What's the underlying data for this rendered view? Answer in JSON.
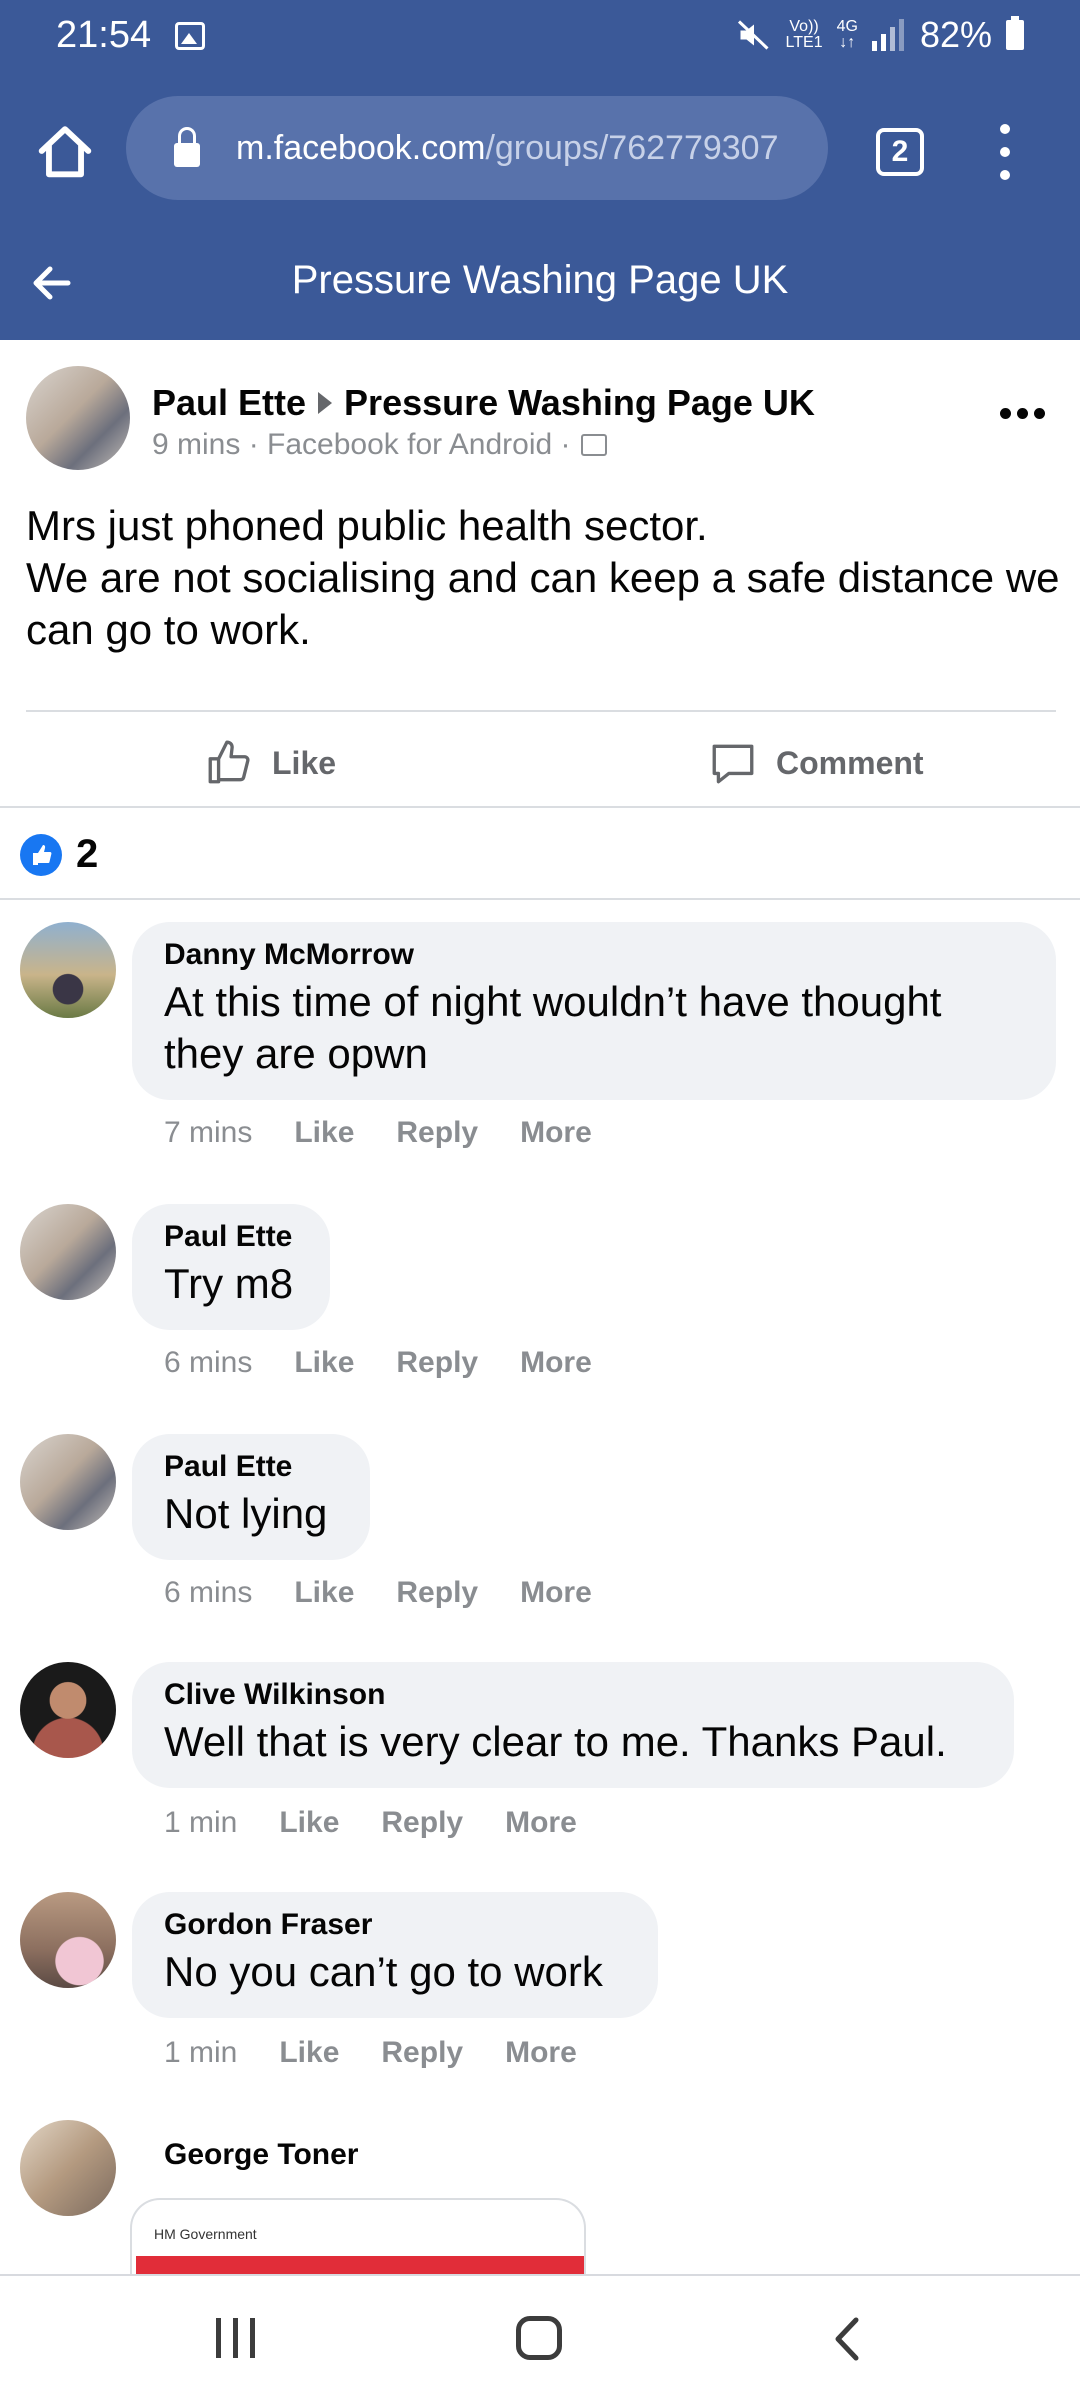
{
  "status_bar": {
    "time": "21:54",
    "volte": "Vo))",
    "lte": "LTE1",
    "network": "4G",
    "battery": "82%"
  },
  "browser": {
    "url_domain": "m.facebook.com",
    "url_path": "/groups/762779307",
    "tab_count": "2"
  },
  "header": {
    "title": "Pressure Washing Page UK"
  },
  "post": {
    "author": "Paul Ette",
    "group": "Pressure Washing Page UK",
    "meta": "9 mins · Facebook for Android ·",
    "line1": "Mrs just phoned public health sector.",
    "line2": "We are not socialising and can keep a safe distance we can go to work.",
    "like_label": "Like",
    "comment_label": "Comment",
    "reaction_count": "2"
  },
  "comments": [
    {
      "name": "Danny McMorrow",
      "text": "At this time of night wouldn’t have thought they are opwn",
      "time": "7 mins",
      "like": "Like",
      "reply": "Reply",
      "more": "More"
    },
    {
      "name": "Paul Ette",
      "text": "Try m8",
      "time": "6 mins",
      "like": "Like",
      "reply": "Reply",
      "more": "More"
    },
    {
      "name": "Paul Ette",
      "text": "Not lying",
      "time": "6 mins",
      "like": "Like",
      "reply": "Reply",
      "more": "More"
    },
    {
      "name": "Clive Wilkinson",
      "text": "Well that is very clear to me. Thanks Paul.",
      "time": "1 min",
      "like": "Like",
      "reply": "Reply",
      "more": "More"
    },
    {
      "name": "Gordon Fraser",
      "text": "No you can’t go to work",
      "time": "1 min",
      "like": "Like",
      "reply": "Reply",
      "more": "More"
    },
    {
      "name": "George Toner",
      "embed_source": "HM Government"
    }
  ],
  "colors": {
    "brand": "#3b5998",
    "like_blue": "#1877f2",
    "bubble": "#f0f2f5",
    "muted": "#8a8d91",
    "alert_red": "#e12d39"
  }
}
